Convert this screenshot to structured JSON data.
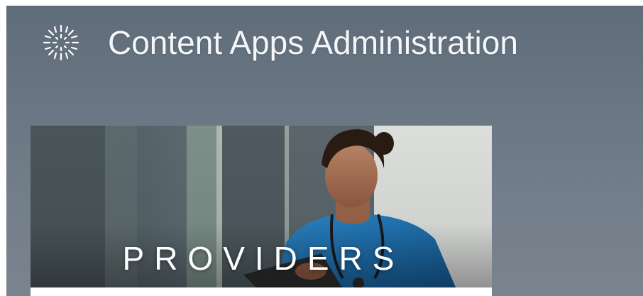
{
  "header": {
    "title": "Content Apps Administration",
    "logo_icon": "sunburst-icon"
  },
  "tiles": [
    {
      "label": "PROVIDERS",
      "image": "nurse-with-tablet-photo"
    }
  ],
  "colors": {
    "background": "#6a7683",
    "title_text": "#f4f6f8",
    "scrubs": "#1f73b8"
  }
}
